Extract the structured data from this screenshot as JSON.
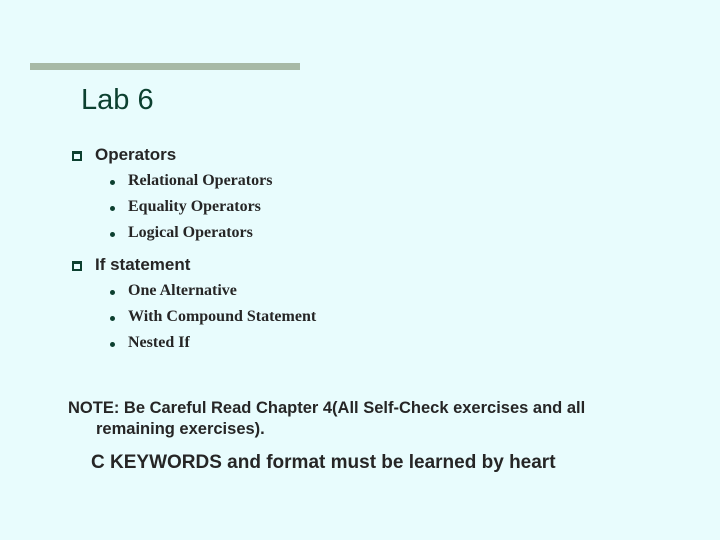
{
  "slide": {
    "title": "Lab 6",
    "sections": [
      {
        "heading": "Operators",
        "items": [
          "Relational Operators",
          "Equality Operators",
          "Logical Operators"
        ]
      },
      {
        "heading": "If statement",
        "items": [
          "One Alternative",
          "With Compound Statement",
          "Nested If"
        ]
      }
    ],
    "note_line1": "NOTE: Be Careful Read Chapter 4(All Self-Check exercises and all",
    "note_line2": "remaining exercises).",
    "keywords_note": "C KEYWORDS and format must be learned by heart"
  },
  "colors": {
    "background": "#e8fcfd",
    "rule": "#a7b9a6",
    "title": "#0c4030",
    "text": "#262626"
  }
}
